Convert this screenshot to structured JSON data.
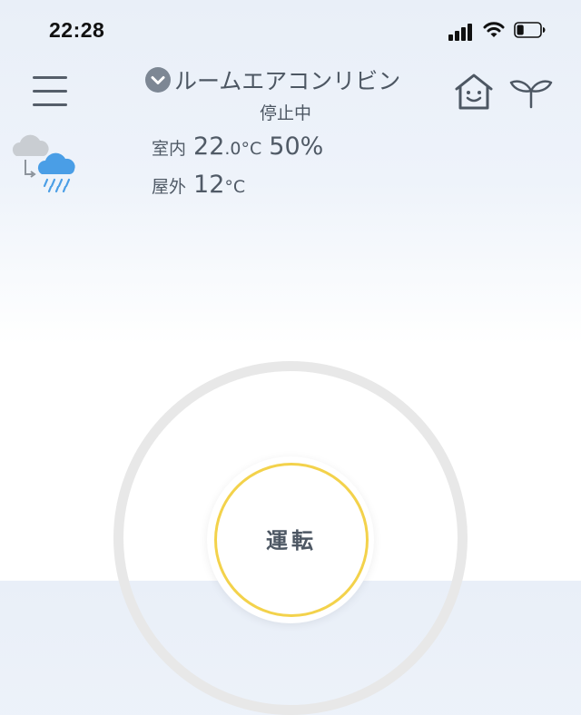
{
  "status_bar": {
    "time": "22:28",
    "icons": [
      "cellular-signal-icon",
      "wifi-icon",
      "battery-icon"
    ],
    "battery_level": 0.3
  },
  "header": {
    "menu_icon": "hamburger-menu-icon",
    "device_name": "ルームエアコンリビン",
    "device_status": "停止中",
    "dropdown_icon": "chevron-down-circle-icon",
    "right_icons": [
      "home-face-icon",
      "sprout-icon"
    ]
  },
  "weather": {
    "icon": "cloud-to-rain-icon",
    "indoor": {
      "label": "室内",
      "temp_int": "22",
      "temp_dec": ".0",
      "temp_unit": "°C",
      "humidity": "50",
      "humidity_unit": "%"
    },
    "outdoor": {
      "label": "屋外",
      "temp": "12",
      "temp_unit": "°C"
    }
  },
  "control": {
    "run_label": "運転"
  },
  "colors": {
    "text": "#4d5763",
    "accent_ring": "#f3d24b",
    "dial_ring": "#e8e8e8",
    "rain_blue": "#4a9ee6",
    "cloud_gray": "#c9cdd2"
  }
}
